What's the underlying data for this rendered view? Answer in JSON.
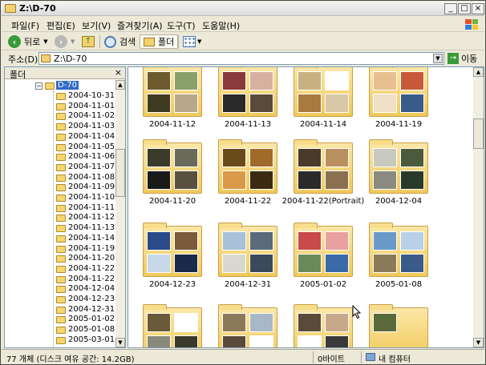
{
  "window": {
    "title": "Z:\\D-70"
  },
  "titlebar_buttons": {
    "minimize": "_",
    "maximize": "□",
    "close": "×"
  },
  "menu": [
    "파일(F)",
    "편집(E)",
    "보기(V)",
    "즐겨찾기(A)",
    "도구(T)",
    "도움말(H)"
  ],
  "toolbar": {
    "back": "뒤로",
    "search": "검색",
    "folders": "폴더"
  },
  "address": {
    "label": "주소(D)",
    "value": "Z:\\D-70",
    "go": "이동"
  },
  "tree": {
    "header": "폴더",
    "close": "×",
    "root": "D-70",
    "items": [
      "2004-10-31",
      "2004-11-01",
      "2004-11-02",
      "2004-11-03",
      "2004-11-04",
      "2004-11-05",
      "2004-11-06",
      "2004-11-07",
      "2004-11-08",
      "2004-11-09",
      "2004-11-10",
      "2004-11-11",
      "2004-11-12",
      "2004-11-13",
      "2004-11-14",
      "2004-11-19",
      "2004-11-20",
      "2004-11-22",
      "2004-11-22(Po",
      "2004-12-04",
      "2004-12-23",
      "2004-12-31",
      "2005-01-02",
      "2005-01-08",
      "2005-03-01"
    ]
  },
  "folders": [
    "2004-11-12",
    "2004-11-13",
    "2004-11-14",
    "2004-11-19",
    "2004-11-20",
    "2004-11-22",
    "2004-11-22(Portrait)",
    "2004-12-04",
    "2004-12-23",
    "2004-12-31",
    "2005-01-02",
    "2005-01-08",
    "",
    "",
    "",
    ""
  ],
  "status": {
    "objects": "77 개체 (디스크 여유 공간: 14.2GB)",
    "size": "0바이트",
    "zone": "내 컴퓨터"
  },
  "colors": {
    "selection": "#316ac5",
    "folder": "#f0c95a",
    "chrome": "#ece9d8"
  }
}
